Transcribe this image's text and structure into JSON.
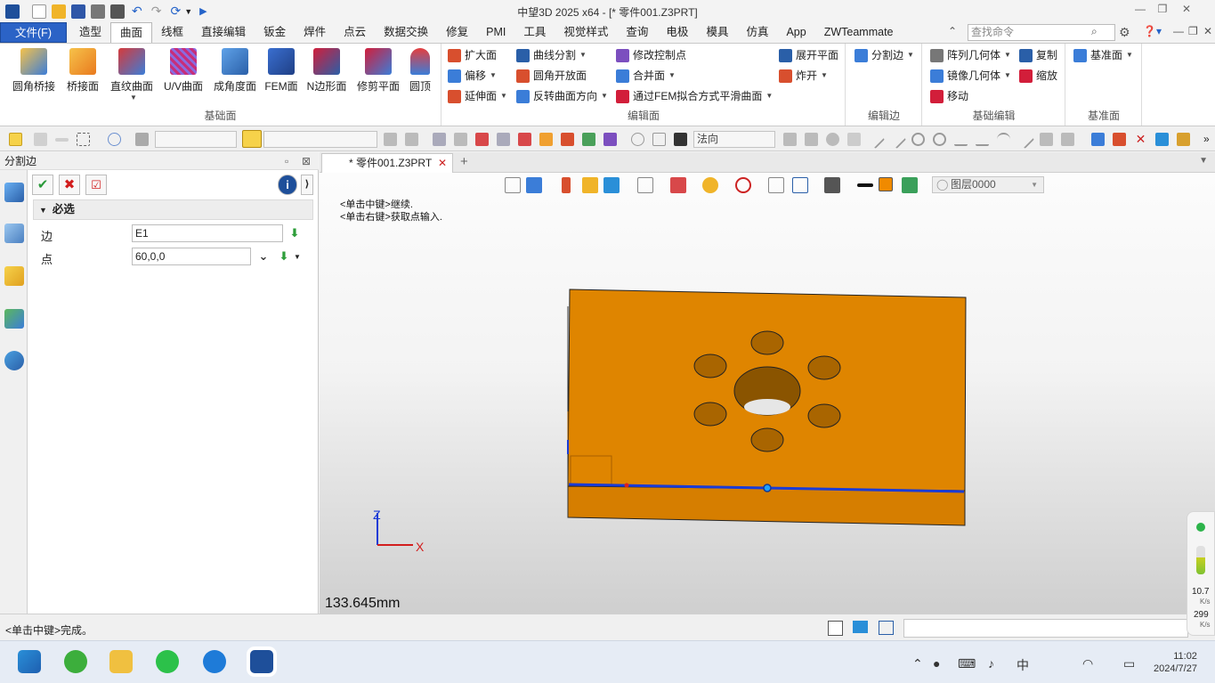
{
  "window": {
    "title": "中望3D 2025 x64 - [* 零件001.Z3PRT]"
  },
  "menu": {
    "file": "文件(F)",
    "tabs": [
      "造型",
      "曲面",
      "线框",
      "直接编辑",
      "钣金",
      "焊件",
      "点云",
      "数据交换",
      "修复",
      "PMI",
      "工具",
      "视觉样式",
      "查询",
      "电极",
      "模具",
      "仿真",
      "App",
      "ZWTeammate"
    ],
    "active_tab": "曲面",
    "search_placeholder": "查找命令"
  },
  "ribbon": {
    "base_surface": {
      "label": "基础面",
      "buttons": [
        "圆角桥接",
        "桥接面",
        "直纹曲面",
        "U/V曲面",
        "成角度面",
        "FEM面",
        "N边形面",
        "修剪平面",
        "圆顶"
      ]
    },
    "edit_surface": {
      "label": "编辑面",
      "col1": [
        "扩大面",
        "偏移",
        "延伸面"
      ],
      "col2": [
        "曲线分割",
        "圆角开放面",
        "反转曲面方向"
      ],
      "col3": [
        "修改控制点",
        "合并面",
        "通过FEM拟合方式平滑曲面"
      ],
      "col4": [
        "展开平面",
        "炸开"
      ]
    },
    "edit_edge": {
      "label": "编辑边",
      "buttons": [
        "分割边"
      ]
    },
    "basic_edit": {
      "label": "基础编辑",
      "col1": [
        "阵列几何体",
        "镜像几何体",
        "移动"
      ],
      "col2": [
        "复制",
        "缩放"
      ]
    },
    "datum": {
      "label": "基准面",
      "buttons": [
        "基准面"
      ]
    }
  },
  "toolbar": {
    "direction_combo": "法向"
  },
  "panel": {
    "title": "分割边",
    "section": "必选",
    "fields": [
      {
        "label": "边",
        "value": "E1"
      },
      {
        "label": "点",
        "value": "60,0,0"
      }
    ]
  },
  "document": {
    "tab_label": "* 零件001.Z3PRT",
    "hint_line1": "<单击中键>继续.",
    "hint_line2": "<单击右键>获取点输入.",
    "layer": "图层0000",
    "measurement": "133.645mm",
    "axis_z": "Z",
    "axis_x": "X",
    "part_color": "#e08a00",
    "highlight_color": "#1a3bd6"
  },
  "status": {
    "message": "<单击中键>完成。"
  },
  "netwidget": {
    "up_value": "10.7",
    "up_unit": "K/s",
    "down_value": "299",
    "down_unit": "K/s"
  },
  "taskbar": {
    "time": "11:02",
    "date": "2024/7/27"
  }
}
